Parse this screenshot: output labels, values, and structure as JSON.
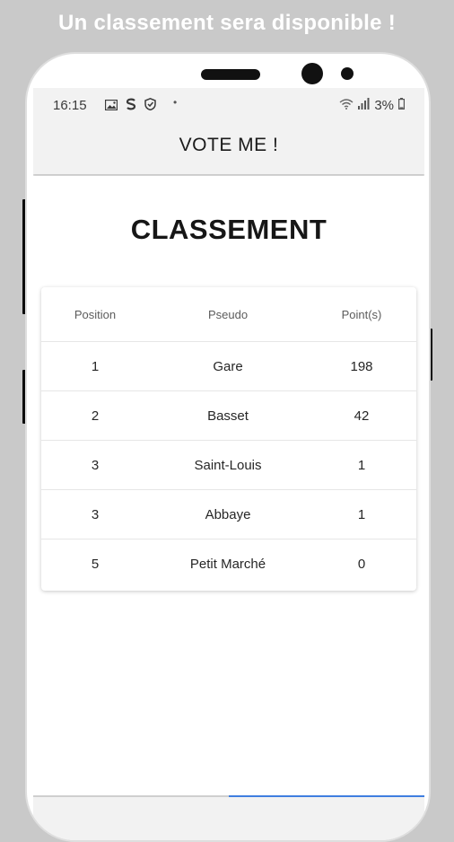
{
  "promo": {
    "banner_text": "Un classement sera disponible !"
  },
  "status_bar": {
    "time": "16:15",
    "battery": "3%",
    "left_icons": [
      "image-icon",
      "s-app-icon",
      "shield-icon"
    ],
    "right_icons": [
      "wifi-icon",
      "signal-icon",
      "battery-icon"
    ]
  },
  "app_bar": {
    "title": "VOTE ME !"
  },
  "page": {
    "heading": "CLASSEMENT"
  },
  "ranking_table": {
    "columns": [
      "Position",
      "Pseudo",
      "Point(s)"
    ],
    "rows": [
      {
        "position": "1",
        "pseudo": "Gare",
        "points": "198"
      },
      {
        "position": "2",
        "pseudo": "Basset",
        "points": "42"
      },
      {
        "position": "3",
        "pseudo": "Saint-Louis",
        "points": "1"
      },
      {
        "position": "3",
        "pseudo": "Abbaye",
        "points": "1"
      },
      {
        "position": "5",
        "pseudo": "Petit Marché",
        "points": "0"
      }
    ]
  },
  "bottom_nav": {
    "active_tab_index": 1,
    "accent_color": "#3f7ee0"
  },
  "colors": {
    "page_background": "#c9c9c9",
    "app_bar_background": "#f2f2f2",
    "promo_text": "#ffffff"
  }
}
